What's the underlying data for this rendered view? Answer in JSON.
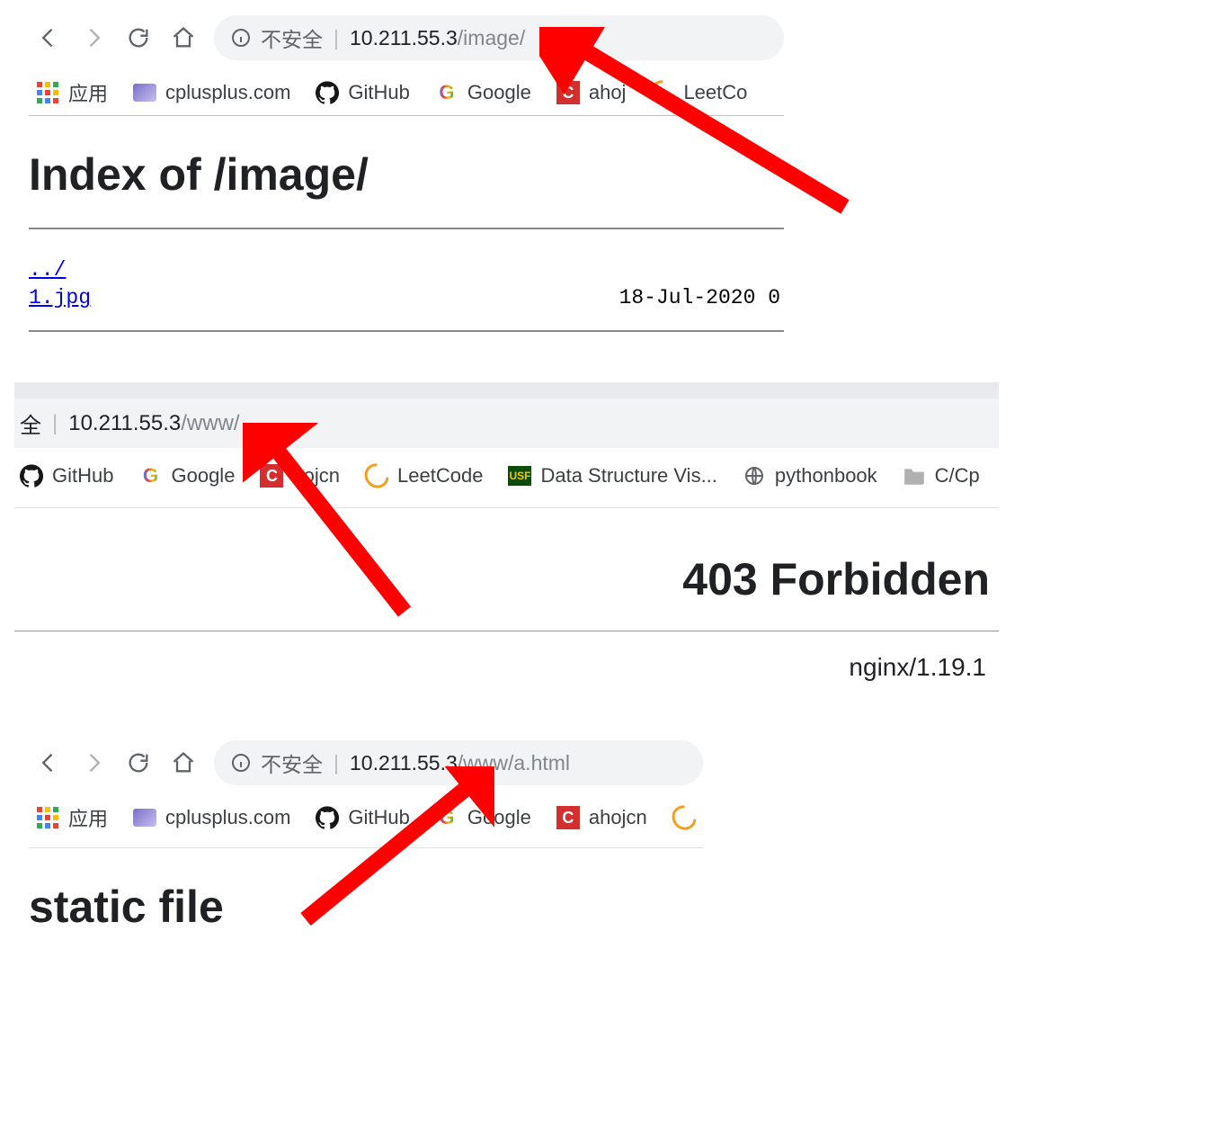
{
  "panel1": {
    "nav": {
      "security_label": "不安全",
      "url_host": "10.211.55.3",
      "url_path": "/image/"
    },
    "bookmarks": {
      "apps": "应用",
      "cplusplus": "cplusplus.com",
      "github": "GitHub",
      "google": "Google",
      "ahojcn_badge": "C",
      "ahojcn": "ahoj",
      "leetcode": "LeetCo"
    },
    "page": {
      "heading": "Index of /image/",
      "parent_link": "../",
      "file_link": "1.jpg",
      "file_date": "18-Jul-2020 0"
    }
  },
  "panel2": {
    "nav": {
      "security_suffix": "全",
      "url_host": "10.211.55.3",
      "url_path": "/www/"
    },
    "bookmarks": {
      "github": "GitHub",
      "google": "Google",
      "ahojcn_badge": "C",
      "ahojcn": "hojcn",
      "leetcode": "LeetCode",
      "usf_badge": "USF",
      "dsv": "Data Structure Vis...",
      "pythonbook": "pythonbook",
      "ccpp": "C/Cp"
    },
    "page": {
      "heading": "403 Forbidden",
      "server": "nginx/1.19.1"
    }
  },
  "panel3": {
    "nav": {
      "security_label": "不安全",
      "url_host": "10.211.55.3",
      "url_path": "/www/a.html"
    },
    "bookmarks": {
      "apps": "应用",
      "cplusplus": "cplusplus.com",
      "github": "GitHub",
      "google": "Google",
      "ahojcn_badge": "C",
      "ahojcn": "ahojcn",
      "leet_mark": "C"
    },
    "page": {
      "heading": "static file"
    }
  }
}
